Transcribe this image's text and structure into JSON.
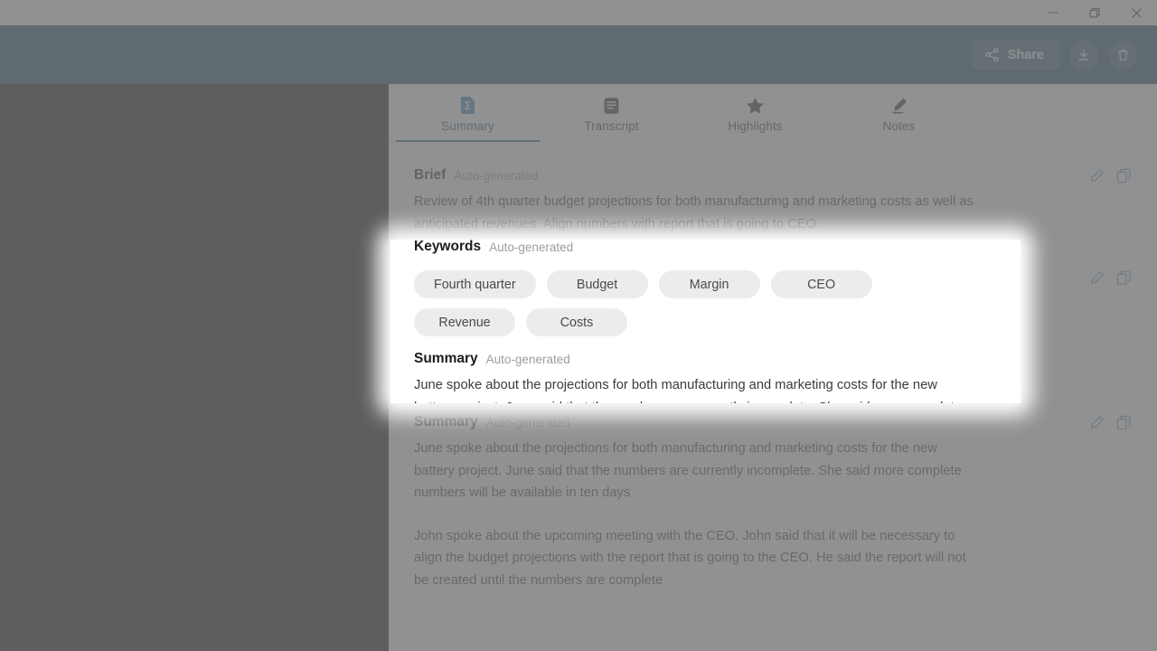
{
  "window": {
    "controls": [
      {
        "name": "minimize",
        "glyph": "minimize-icon"
      },
      {
        "name": "restore",
        "glyph": "restore-icon"
      },
      {
        "name": "close",
        "glyph": "close-icon"
      }
    ]
  },
  "header": {
    "background_color": "#0e3f5f",
    "share_label": "Share",
    "actions": [
      {
        "name": "share-button",
        "label": "Share",
        "icon": "share-icon"
      },
      {
        "name": "download-button",
        "label": "",
        "icon": "download-icon"
      },
      {
        "name": "delete-button",
        "label": "",
        "icon": "trash-icon"
      }
    ]
  },
  "tabs": [
    {
      "label": "Summary",
      "icon": "document-sigma-icon",
      "active": true
    },
    {
      "label": "Transcript",
      "icon": "transcript-lines-icon",
      "active": false
    },
    {
      "label": "Highlights",
      "icon": "star-icon",
      "active": false
    },
    {
      "label": "Notes",
      "icon": "pencil-icon",
      "active": false
    }
  ],
  "tab_accent_color": "#0f5580",
  "sections": {
    "brief": {
      "title": "Brief",
      "subtitle": "Auto-generated",
      "text": "Review of 4th quarter budget projections for both manufacturing and marketing costs as well as anticipated revenues. Align numbers with report that is going to CEO."
    },
    "keywords": {
      "title": "Keywords",
      "subtitle": "Auto-generated",
      "chips": [
        "Fourth quarter",
        "Budget",
        "Margin",
        "CEO",
        "Revenue",
        "Costs"
      ],
      "chip_background": "#ececec"
    },
    "summary": {
      "title": "Summary",
      "subtitle": "Auto-generated",
      "paragraph1": "June spoke about the projections for both manufacturing and marketing costs for the new battery project. June said that the numbers are currently incomplete. She said more complete numbers will be available in ten days",
      "paragraph2": "John spoke about the upcoming meeting with the CEO. John said that it will be necessary to align the budget projections with the report that is going to the CEO. He said the report will not be created until the numbers are complete"
    }
  },
  "section_tools": {
    "edit_icon": "pencil-edit-icon",
    "copy_icon": "copy-icon",
    "color": "#5b9bd0"
  },
  "overlay": {
    "dim_color": "#767676",
    "spotlight_target": "keywords"
  }
}
